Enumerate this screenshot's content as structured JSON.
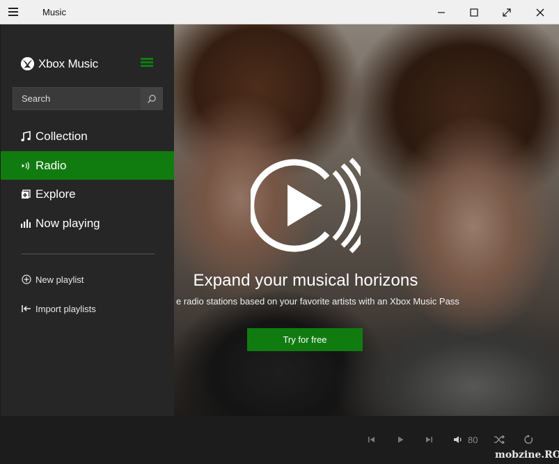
{
  "window": {
    "title": "Music",
    "controls": [
      "minimize-icon",
      "maximize-icon",
      "fullscreen-icon",
      "close-icon"
    ]
  },
  "sidebar": {
    "brand": "Xbox Music",
    "search_placeholder": "Search",
    "nav": [
      {
        "label": "Collection",
        "icon": "music-note-icon",
        "active": false
      },
      {
        "label": "Radio",
        "icon": "radio-icon",
        "active": true
      },
      {
        "label": "Explore",
        "icon": "explore-icon",
        "active": false
      },
      {
        "label": "Now playing",
        "icon": "equalizer-icon",
        "active": false
      }
    ],
    "actions": [
      {
        "label": "New playlist",
        "icon": "add-circle-icon"
      },
      {
        "label": "Import playlists",
        "icon": "import-icon"
      }
    ]
  },
  "hero": {
    "headline": "Expand your musical horizons",
    "subline": "e radio stations based on your favorite artists with an Xbox Music Pass",
    "cta": "Try for free"
  },
  "player": {
    "volume": "80",
    "controls": [
      "previous-icon",
      "play-icon",
      "next-icon",
      "volume-icon",
      "shuffle-icon",
      "repeat-icon"
    ]
  },
  "watermark": "mobzine.RO",
  "colors": {
    "accent": "#107c10",
    "sidebar_bg": "#262626",
    "player_bg": "#1c1c1c",
    "titlebar_bg": "#f0f0f0"
  }
}
